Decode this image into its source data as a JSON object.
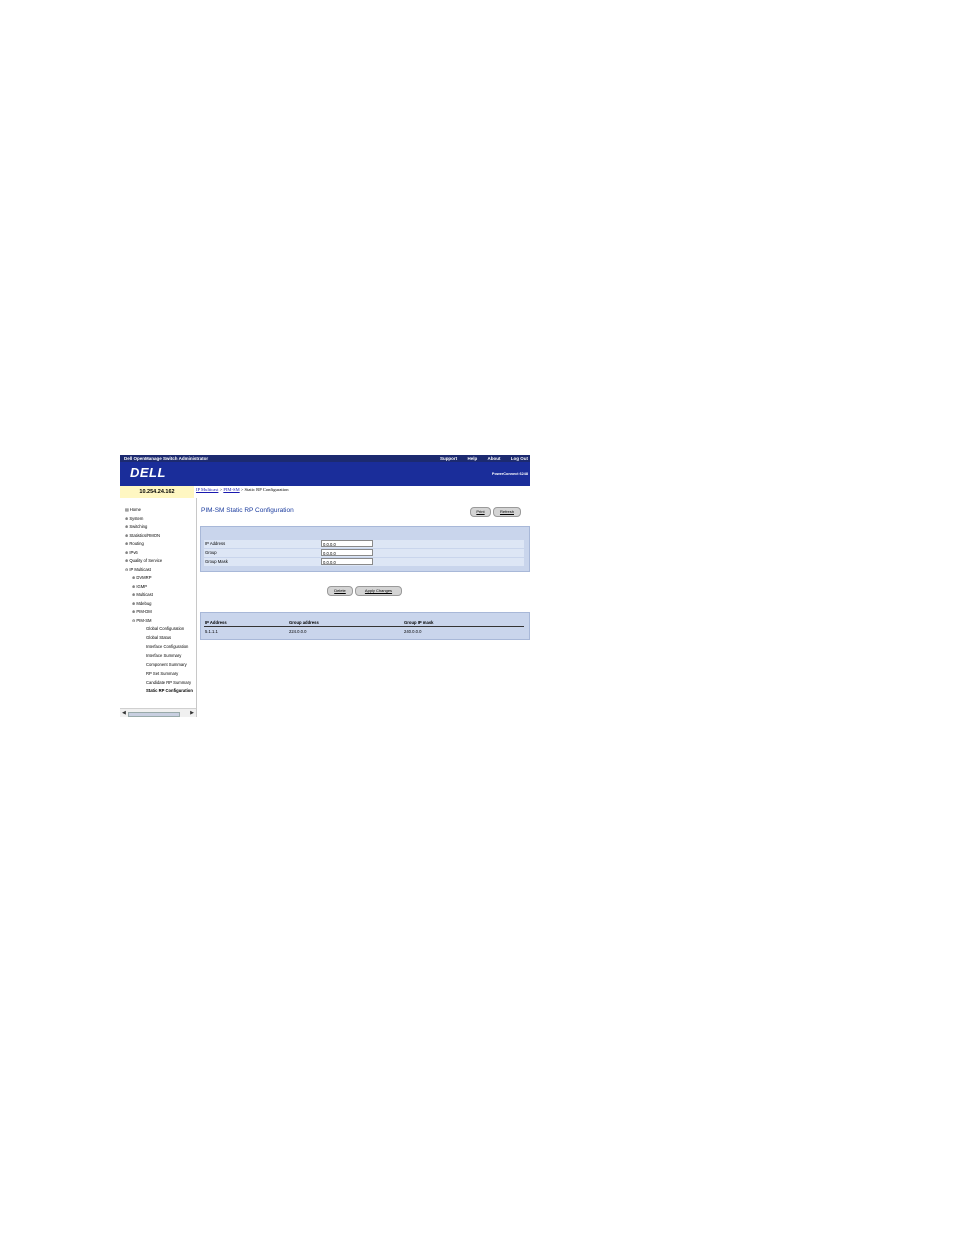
{
  "app": {
    "title": "Dell OpenManage Switch Administrator",
    "links": [
      "Support",
      "Help",
      "About",
      "Log Out"
    ],
    "logo": "DELL",
    "product": "PowerConnect 6248"
  },
  "ip_address": "10.254.24.162",
  "breadcrumb": {
    "parts": [
      "IP Multicast",
      "PIM-SM",
      "Static RP Configuration"
    ],
    "separator": " > "
  },
  "nav": {
    "items": [
      {
        "label": "Home",
        "icon": "home-icon"
      },
      {
        "label": "System",
        "icon": "expand-icon"
      },
      {
        "label": "Switching",
        "icon": "expand-icon"
      },
      {
        "label": "Statistics/RMON",
        "icon": "expand-icon"
      },
      {
        "label": "Routing",
        "icon": "expand-icon"
      },
      {
        "label": "IPv6",
        "icon": "expand-icon"
      },
      {
        "label": "Quality of Service",
        "icon": "expand-icon"
      },
      {
        "label": "IP Multicast",
        "icon": "collapse-icon"
      },
      {
        "label": "DVMRP",
        "icon": "expand-icon"
      },
      {
        "label": "IGMP",
        "icon": "expand-icon"
      },
      {
        "label": "Multicast",
        "icon": "expand-icon"
      },
      {
        "label": "Mdebug",
        "icon": "expand-icon"
      },
      {
        "label": "PIM-DM",
        "icon": "expand-icon"
      },
      {
        "label": "PIM-SM",
        "icon": "collapse-icon"
      },
      {
        "label": "Global Configuration",
        "icon": ""
      },
      {
        "label": "Global Status",
        "icon": ""
      },
      {
        "label": "Interface Configuration",
        "icon": ""
      },
      {
        "label": "Interface Summary",
        "icon": ""
      },
      {
        "label": "Component Summary",
        "icon": ""
      },
      {
        "label": "RP Set Summary",
        "icon": ""
      },
      {
        "label": "Candidate RP Summary",
        "icon": ""
      },
      {
        "label": "Static RP Configuration",
        "icon": ""
      }
    ],
    "selected": "Static RP Configuration"
  },
  "page": {
    "title": "PIM-SM Static RP Configuration",
    "print_label": "Print",
    "refresh_label": "Refresh"
  },
  "form": {
    "ip_address_label": "IP Address",
    "ip_address_value": "0.0.0.0",
    "group_label": "Group",
    "group_value": "0.0.0.0",
    "group_mask_label": "Group Mask",
    "group_mask_value": "0.0.0.0",
    "delete_label": "Delete",
    "apply_label": "Apply Changes"
  },
  "table": {
    "headers": [
      "IP Address",
      "Group address",
      "Group IP mask"
    ],
    "rows": [
      [
        "5.1.1.1",
        "224.0.0.0",
        "240.0.0.0"
      ]
    ]
  }
}
